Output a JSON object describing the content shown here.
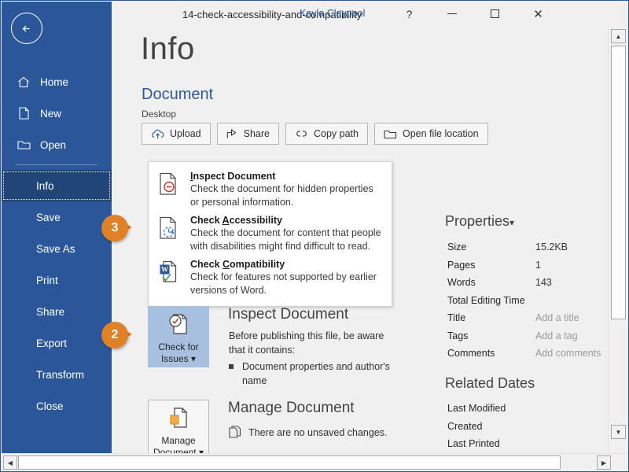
{
  "window": {
    "title": "14-check-accessibility-and-compatibility",
    "user": "Kayla Claypool",
    "help": "?",
    "minimize": "—",
    "maximize": "",
    "close": "✕"
  },
  "sidebar": {
    "back": "back-arrow",
    "items": [
      {
        "label": "Home",
        "icon": "home-icon",
        "sub": false,
        "selected": false
      },
      {
        "label": "New",
        "icon": "new-document-icon",
        "sub": false,
        "selected": false
      },
      {
        "label": "Open",
        "icon": "open-folder-icon",
        "sub": false,
        "selected": false
      },
      {
        "label": "Info",
        "icon": "",
        "sub": true,
        "selected": true
      },
      {
        "label": "Save",
        "icon": "",
        "sub": true,
        "selected": false
      },
      {
        "label": "Save As",
        "icon": "",
        "sub": true,
        "selected": false
      },
      {
        "label": "Print",
        "icon": "",
        "sub": true,
        "selected": false
      },
      {
        "label": "Share",
        "icon": "",
        "sub": true,
        "selected": false
      },
      {
        "label": "Export",
        "icon": "",
        "sub": true,
        "selected": false
      },
      {
        "label": "Transform",
        "icon": "",
        "sub": true,
        "selected": false
      },
      {
        "label": "Close",
        "icon": "",
        "sub": true,
        "selected": false
      }
    ]
  },
  "page": {
    "title": "Info",
    "document_heading": "Document",
    "document_path": "Desktop"
  },
  "actions": [
    {
      "label": "Upload",
      "icon": "cloud-upload-icon"
    },
    {
      "label": "Share",
      "icon": "share-icon"
    },
    {
      "label": "Copy path",
      "icon": "link-icon"
    },
    {
      "label": "Open file location",
      "icon": "folder-open-icon"
    }
  ],
  "menu": {
    "items": [
      {
        "title_pre": "",
        "title_key": "I",
        "title_post": "nspect Document",
        "desc": "Check the document for hidden properties or personal information.",
        "icon": "inspect-document-icon"
      },
      {
        "title_pre": "Check ",
        "title_key": "A",
        "title_post": "ccessibility",
        "desc": "Check the document for content that people with disabilities might find difficult to read.",
        "icon": "check-accessibility-icon"
      },
      {
        "title_pre": "Check ",
        "title_key": "C",
        "title_post": "ompatibility",
        "desc": "Check for features not supported by earlier versions of Word.",
        "icon": "check-compatibility-icon"
      }
    ]
  },
  "inspect_block": {
    "button_line1": "Check for",
    "button_line2": "Issues",
    "button_caret": "▾",
    "heading": "Inspect Document",
    "body": "Before publishing this file, be aware that it contains:",
    "bullet": "Document properties and author's name"
  },
  "manage_block": {
    "button_line1": "Manage",
    "button_line2": "Document",
    "button_caret": "▾",
    "heading": "Manage Document",
    "status": "There are no unsaved changes."
  },
  "properties": {
    "title": "Properties",
    "caret": "▾",
    "rows": [
      {
        "key": "Size",
        "value": "15.2KB",
        "placeholder": false
      },
      {
        "key": "Pages",
        "value": "1",
        "placeholder": false
      },
      {
        "key": "Words",
        "value": "143",
        "placeholder": false
      },
      {
        "key": "Total Editing Time",
        "value": "",
        "placeholder": false
      },
      {
        "key": "Title",
        "value": "Add a title",
        "placeholder": true
      },
      {
        "key": "Tags",
        "value": "Add a tag",
        "placeholder": true
      },
      {
        "key": "Comments",
        "value": "Add comments",
        "placeholder": true
      }
    ]
  },
  "related_dates": {
    "title": "Related Dates",
    "rows": [
      {
        "key": "Last Modified",
        "value": ""
      },
      {
        "key": "Created",
        "value": ""
      },
      {
        "key": "Last Printed",
        "value": ""
      }
    ]
  },
  "badges": [
    {
      "number": "3"
    },
    {
      "number": "2"
    }
  ],
  "colors": {
    "brand_blue": "#2b579a",
    "selected_blue": "#204576",
    "badge_orange": "#e08127",
    "active_button": "#a8c0e0"
  }
}
